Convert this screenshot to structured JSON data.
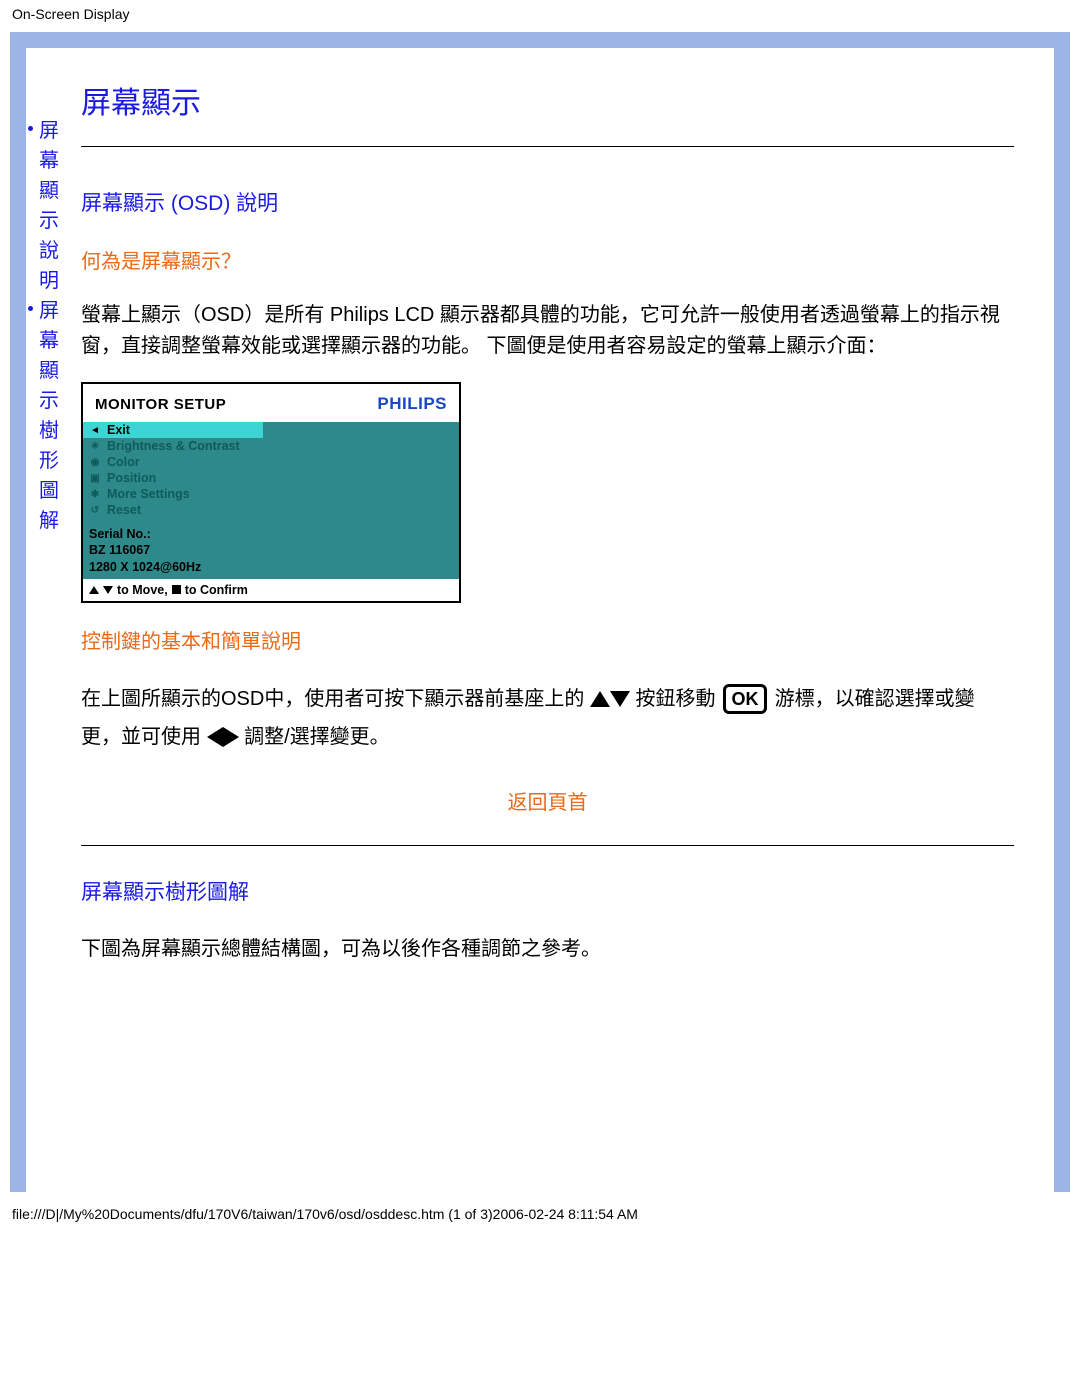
{
  "header": {
    "title": "On-Screen Display"
  },
  "sidebar": {
    "link1": "屏幕顯示說明",
    "link2": "屏幕顯示樹形圖解"
  },
  "page": {
    "title": "屏幕顯示",
    "section1_title": "屏幕顯示 (OSD) 說明",
    "q1": "何為是屏幕顯示？",
    "p1": "螢幕上顯示（OSD）是所有 Philips LCD 顯示器都具體的功能，它可允許一般使用者透過螢幕上的指示視窗，直接調整螢幕效能或選擇顯示器的功能。 下圖便是使用者容易設定的螢幕上顯示介面：",
    "controls_title": "控制鍵的基本和簡單說明",
    "ctrl_a": "在上圖所顯示的OSD中，使用者可按下顯示器前基座上的 ",
    "ctrl_b": " 按鈕移動 ",
    "ctrl_c": " 游標，以確認選擇或變更，並可使用 ",
    "ctrl_d": " 調整/選擇變更。",
    "back_top": "返回頁首",
    "section2_title": "屏幕顯示樹形圖解",
    "p2": "下圖為屏幕顯示總體結構圖，可為以後作各種調節之參考。"
  },
  "osd": {
    "header": "MONITOR SETUP",
    "brand": "PHILIPS",
    "items": [
      "Exit",
      "Brightness & Contrast",
      "Color",
      "Position",
      "More Settings",
      "Reset"
    ],
    "serial_label": "Serial No.:",
    "serial": "BZ 116067",
    "res": "1280 X 1024@60Hz",
    "footer_move": " to Move, ",
    "footer_confirm": " to Confirm",
    "ok": "OK"
  },
  "footer": {
    "path": "file:///D|/My%20Documents/dfu/170V6/taiwan/170v6/osd/osddesc.htm (1 of 3)2006-02-24 8:11:54 AM"
  }
}
